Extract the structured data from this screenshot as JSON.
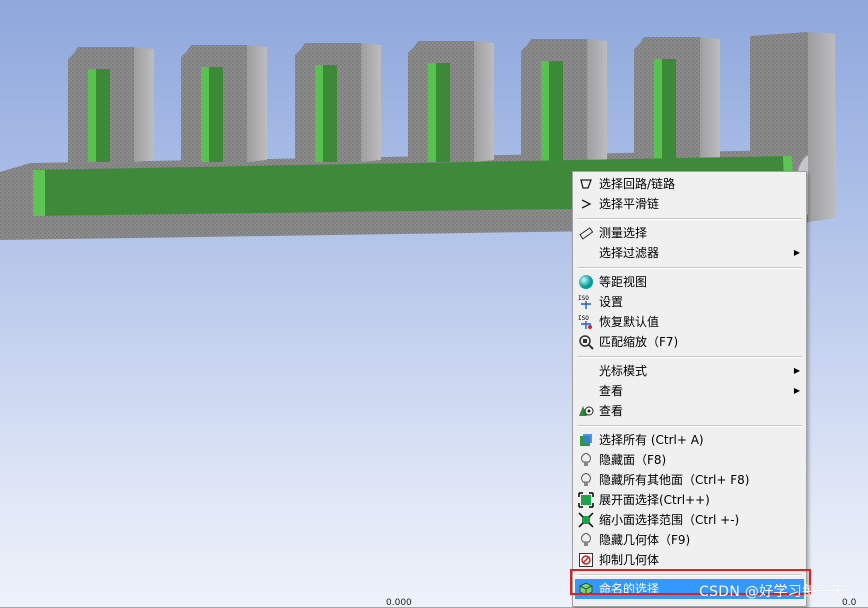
{
  "context_menu": {
    "groups": [
      [
        {
          "label": "选择回路/链路",
          "icon": "select-loop-icon"
        },
        {
          "label": "选择平滑链",
          "icon": "smooth-chain-icon"
        }
      ],
      [
        {
          "label": "测量选择",
          "icon": "measure-icon"
        },
        {
          "label": "选择过滤器",
          "icon": "",
          "submenu": true
        }
      ],
      [
        {
          "label": "等距视图",
          "icon": "isometric-sphere-icon"
        },
        {
          "label": "设置",
          "icon": "iso-settings-icon"
        },
        {
          "label": "恢复默认值",
          "icon": "iso-restore-icon"
        },
        {
          "label": "匹配缩放（F7)",
          "icon": "zoom-fit-icon"
        }
      ],
      [
        {
          "label": "光标模式",
          "icon": "",
          "submenu": true
        },
        {
          "label": "查看",
          "icon": "",
          "submenu": true
        },
        {
          "label": "查看",
          "icon": "view-icon"
        }
      ],
      [
        {
          "label": "选择所有 (Ctrl+ A)",
          "icon": "select-all-icon"
        },
        {
          "label": "隐藏面（F8)",
          "icon": "hide-face-icon"
        },
        {
          "label": "隐藏所有其他面（Ctrl+ F8)",
          "icon": "hide-others-icon"
        },
        {
          "label": "展开面选择(Ctrl++)",
          "icon": "expand-selection-icon"
        },
        {
          "label": "缩小面选择范围（Ctrl +-)",
          "icon": "shrink-selection-icon"
        },
        {
          "label": "隐藏几何体（F9)",
          "icon": "hide-body-icon"
        },
        {
          "label": "抑制几何体",
          "icon": "suppress-body-icon"
        }
      ],
      [
        {
          "label": "命名的选择",
          "icon": "named-selection-icon",
          "highlighted": true
        }
      ]
    ]
  },
  "watermark": "CSDN @好学习每一天",
  "axis_ticks": [
    "0.000",
    "0.0"
  ],
  "colors": {
    "highlight": "#3399ff",
    "annotation_box": "#e02020",
    "model_gray": "#8a8a8a",
    "model_green": "#3e8a3a"
  }
}
